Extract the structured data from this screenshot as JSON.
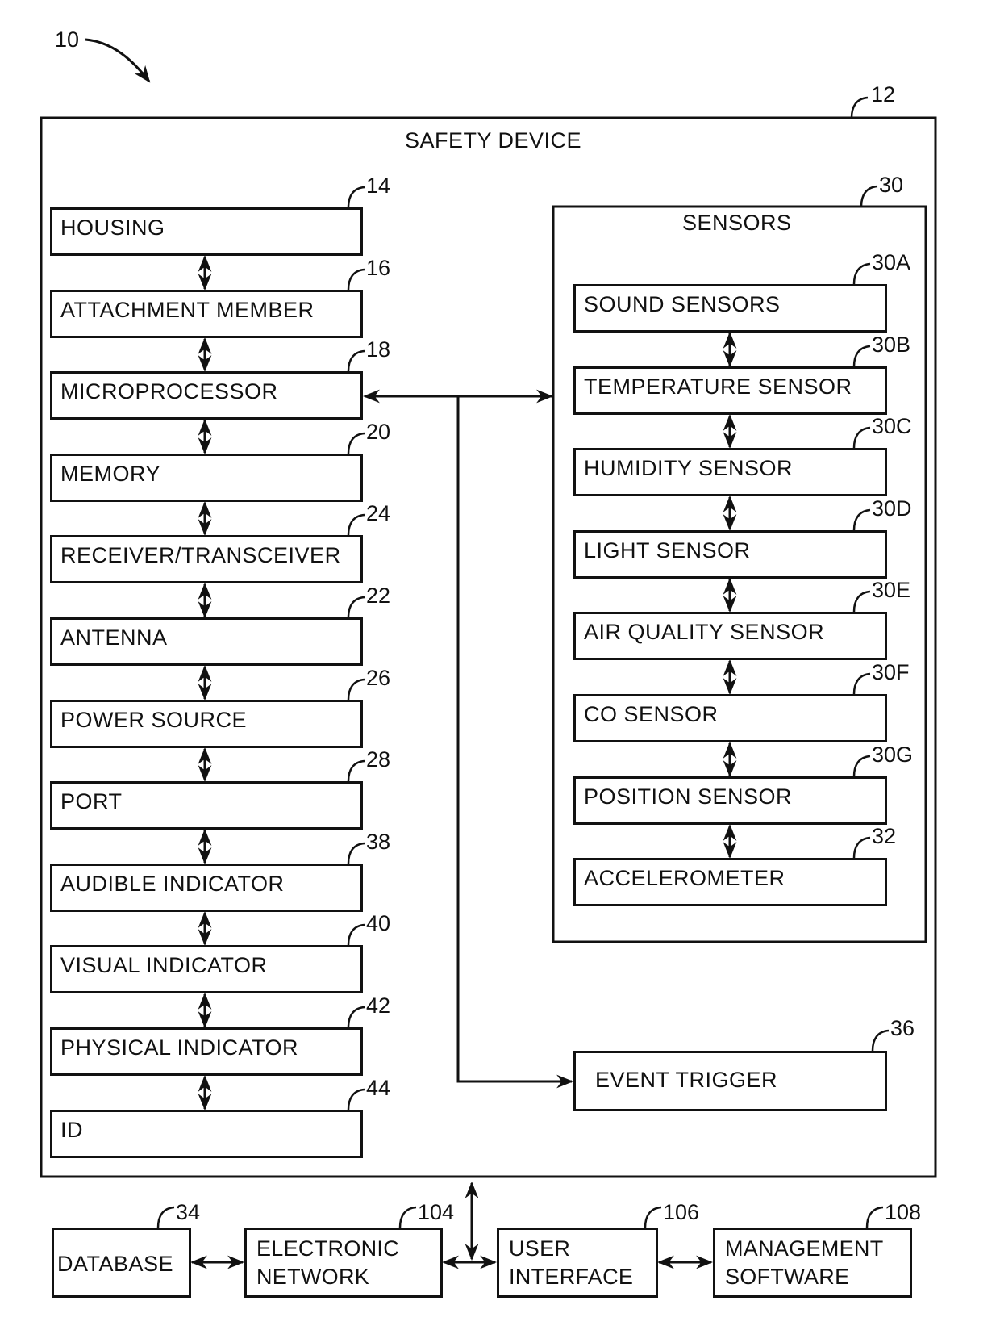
{
  "figure_ref": "10",
  "safety_device": {
    "title": "SAFETY DEVICE",
    "ref": "12",
    "components": [
      {
        "label": "HOUSING",
        "ref": "14"
      },
      {
        "label": "ATTACHMENT MEMBER",
        "ref": "16"
      },
      {
        "label": "MICROPROCESSOR",
        "ref": "18"
      },
      {
        "label": "MEMORY",
        "ref": "20"
      },
      {
        "label": "RECEIVER/TRANSCEIVER",
        "ref": "24"
      },
      {
        "label": "ANTENNA",
        "ref": "22"
      },
      {
        "label": "POWER SOURCE",
        "ref": "26"
      },
      {
        "label": "PORT",
        "ref": "28"
      },
      {
        "label": "AUDIBLE INDICATOR",
        "ref": "38"
      },
      {
        "label": "VISUAL INDICATOR",
        "ref": "40"
      },
      {
        "label": "PHYSICAL INDICATOR",
        "ref": "42"
      },
      {
        "label": "ID",
        "ref": "44"
      }
    ],
    "sensors": {
      "title": "SENSORS",
      "ref": "30",
      "items": [
        {
          "label": "SOUND SENSORS",
          "ref": "30A"
        },
        {
          "label": "TEMPERATURE SENSOR",
          "ref": "30B"
        },
        {
          "label": "HUMIDITY SENSOR",
          "ref": "30C"
        },
        {
          "label": "LIGHT SENSOR",
          "ref": "30D"
        },
        {
          "label": "AIR QUALITY SENSOR",
          "ref": "30E"
        },
        {
          "label": "CO SENSOR",
          "ref": "30F"
        },
        {
          "label": "POSITION SENSOR",
          "ref": "30G"
        },
        {
          "label": "ACCELEROMETER",
          "ref": "32"
        }
      ]
    },
    "event_trigger": {
      "label": "EVENT TRIGGER",
      "ref": "36"
    }
  },
  "external": [
    {
      "line1": "DATABASE",
      "line2": "",
      "ref": "34"
    },
    {
      "line1": "ELECTRONIC",
      "line2": "NETWORK",
      "ref": "104"
    },
    {
      "line1": "USER",
      "line2": "INTERFACE",
      "ref": "106"
    },
    {
      "line1": "MANAGEMENT",
      "line2": "SOFTWARE",
      "ref": "108"
    }
  ]
}
